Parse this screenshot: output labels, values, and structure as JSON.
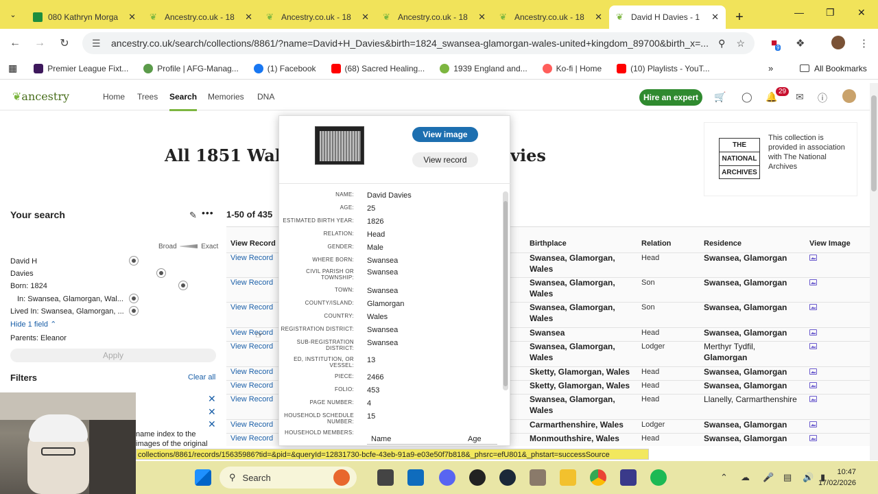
{
  "browser": {
    "tabs": [
      {
        "title": "080 Kathryn Morga",
        "color": "#1e8e3e"
      },
      {
        "title": "Ancestry.co.uk - 18",
        "color": "#7db640"
      },
      {
        "title": "Ancestry.co.uk - 18",
        "color": "#7db640"
      },
      {
        "title": "Ancestry.co.uk - 18",
        "color": "#7db640"
      },
      {
        "title": "Ancestry.co.uk - 18",
        "color": "#7db640"
      },
      {
        "title": "David H Davies - 1",
        "color": "#7db640",
        "active": true
      }
    ],
    "url": "ancestry.co.uk/search/collections/8861/?name=David+H_Davies&birth=1824_swansea-glamorgan-wales-united+kingdom_89700&birth_x=...",
    "extension_badge": "9",
    "bookmarks": [
      {
        "label": "Premier League Fixt...",
        "color": "#3d185c"
      },
      {
        "label": "Profile | AFG-Manag...",
        "color": "#5b9b4a"
      },
      {
        "label": "(1) Facebook",
        "color": "#1877f2"
      },
      {
        "label": "(68) Sacred Healing...",
        "color": "#ff0000"
      },
      {
        "label": "1939 England and...",
        "color": "#7db640"
      },
      {
        "label": "Ko-fi | Home",
        "color": "#ff5e5b"
      },
      {
        "label": "(10) Playlists - YouT...",
        "color": "#ff0000"
      }
    ],
    "all_bookmarks": "All Bookmarks"
  },
  "ancestry": {
    "logo": "ancestry",
    "nav": [
      "Home",
      "Trees",
      "Search",
      "Memories",
      "DNA"
    ],
    "active_nav": "Search",
    "hire_expert": "Hire an expert",
    "notifications_count": "29"
  },
  "page": {
    "title_left": "All 1851 Wales",
    "title_right": "vies",
    "tna_logo": [
      "THE",
      "NATIONAL",
      "ARCHIVES"
    ],
    "tna_text": "This collection is provided in association with The National Archives"
  },
  "your_search": {
    "title": "Your search",
    "scale_broad": "Broad",
    "scale_exact": "Exact",
    "terms": [
      "David H",
      "Davies",
      "Born: 1824",
      "In: Swansea, Glamorgan, Wal...",
      "Lived In: Swansea, Glamorgan, ...",
      "Parents:  Eleanor"
    ],
    "hide_field": "Hide 1 field",
    "apply": "Apply",
    "filters": "Filters",
    "clear_all": "Clear all"
  },
  "webcam_text": [
    "name index to the",
    "images of the original"
  ],
  "results": {
    "count": "1-50 of 435",
    "headers": {
      "view_record": "View Record",
      "birthplace": "Birthplace",
      "relation": "Relation",
      "residence": "Residence",
      "view_image": "View Image"
    },
    "link_label": "View Record",
    "rows": [
      {
        "birthplace": [
          "Swansea, Glamorgan,",
          "Wales"
        ],
        "relation": "Head",
        "residence": [
          "Swansea, Glamorgan"
        ]
      },
      {
        "birthplace": [
          "Swansea, Glamorgan,",
          "Wales"
        ],
        "relation": "Son",
        "residence": [
          "Swansea, Glamorgan"
        ]
      },
      {
        "birthplace": [
          "Swansea, Glamorgan,",
          "Wales"
        ],
        "relation": "Son",
        "residence": [
          "Swansea, Glamorgan"
        ]
      },
      {
        "birthplace": [
          "Swansea"
        ],
        "relation": "Head",
        "residence": [
          "Swansea, Glamorgan"
        ]
      },
      {
        "birthplace": [
          "Swansea, Glamorgan,",
          "Wales"
        ],
        "relation": "Lodger",
        "residence": [
          "Merthyr Tydfil,",
          "Glamorgan"
        ]
      },
      {
        "birthplace": [
          "Sketty, Glamorgan, Wales"
        ],
        "relation": "Head",
        "residence": [
          "Swansea, Glamorgan"
        ]
      },
      {
        "birthplace": [
          "Sketty, Glamorgan, Wales"
        ],
        "relation": "Head",
        "residence": [
          "Swansea, Glamorgan"
        ]
      },
      {
        "birthplace": [
          "Swansea, Glamorgan,",
          "Wales"
        ],
        "relation": "Head",
        "residence": [
          "Llanelly, Carmarthenshire"
        ]
      },
      {
        "birthplace": [
          "Carmarthenshire, Wales"
        ],
        "relation": "Lodger",
        "residence": [
          "Swansea, Glamorgan"
        ]
      },
      {
        "birthplace": [
          "Monmouthshire, Wales"
        ],
        "relation": "Head",
        "residence": [
          "Swansea, Glamorgan"
        ]
      },
      {
        "birthplace": [
          ""
        ],
        "relation": "ad",
        "residence": [
          "Swansea, Glamorgan"
        ]
      }
    ]
  },
  "popup": {
    "view_image": "View image",
    "view_record": "View record",
    "fields": [
      {
        "k": "Name:",
        "v": "David Davies"
      },
      {
        "k": "Age:",
        "v": "25"
      },
      {
        "k": "Estimated birth year:",
        "v": "1826"
      },
      {
        "k": "Relation:",
        "v": "Head"
      },
      {
        "k": "Gender:",
        "v": "Male"
      },
      {
        "k": "Where born:",
        "v": "Swansea"
      },
      {
        "k": "Civil parish or township:",
        "v": "Swansea"
      },
      {
        "k": "Town:",
        "v": "Swansea"
      },
      {
        "k": "County/Island:",
        "v": "Glamorgan"
      },
      {
        "k": "Country:",
        "v": "Wales"
      },
      {
        "k": "Registration district:",
        "v": "Swansea"
      },
      {
        "k": "Sub-registration district:",
        "v": "Swansea"
      },
      {
        "k": "ED, institution, or vessel:",
        "v": "13"
      },
      {
        "k": "Piece:",
        "v": "2466"
      },
      {
        "k": "Folio:",
        "v": "453"
      },
      {
        "k": "Page Number:",
        "v": "4"
      },
      {
        "k": "Household schedule number:",
        "v": "15"
      },
      {
        "k": "Household Members:",
        "v": ""
      }
    ],
    "members_headers": {
      "name": "Name",
      "age": "Age"
    }
  },
  "status_url": "collections/8861/records/15635986?tid=&pid=&queryId=12831730-bcfe-43eb-91a9-e03e50f7b818&_phsrc=efU801&_phstart=successSource",
  "taskbar": {
    "search": "Search",
    "time": "10:47",
    "date": "17/02/2026"
  }
}
